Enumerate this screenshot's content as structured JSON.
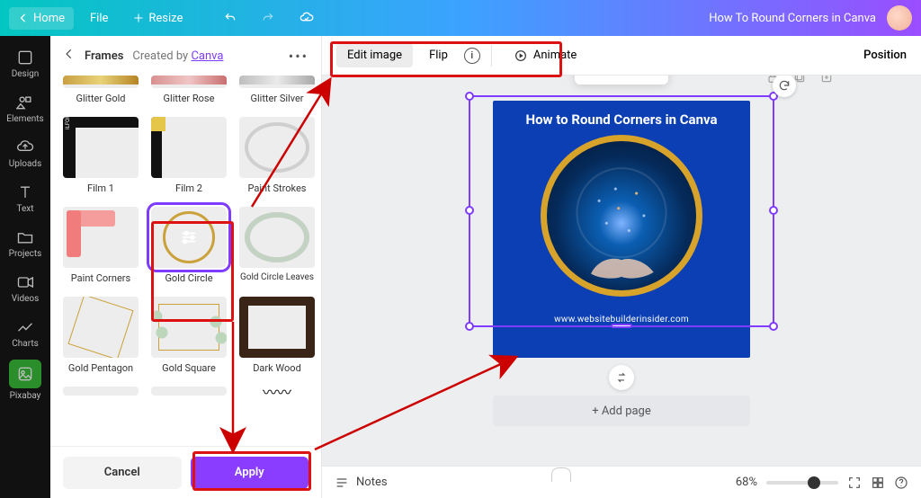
{
  "topbar": {
    "home": "Home",
    "file": "File",
    "resize": "Resize",
    "title": "How To Round Corners in Canva"
  },
  "rail": {
    "design": "Design",
    "elements": "Elements",
    "uploads": "Uploads",
    "text": "Text",
    "projects": "Projects",
    "videos": "Videos",
    "charts": "Charts",
    "pixabay": "Pixabay"
  },
  "panel": {
    "title": "Frames",
    "created_by": "Created by",
    "author": "Canva",
    "items": [
      {
        "id": "glitter-gold",
        "label": "Glitter Gold"
      },
      {
        "id": "glitter-rose",
        "label": "Glitter Rose"
      },
      {
        "id": "glitter-silver",
        "label": "Glitter Silver"
      },
      {
        "id": "film-1",
        "label": "Film 1"
      },
      {
        "id": "film-2",
        "label": "Film 2"
      },
      {
        "id": "paint-strokes",
        "label": "Paint Strokes"
      },
      {
        "id": "paint-corners",
        "label": "Paint Corners"
      },
      {
        "id": "gold-circle",
        "label": "Gold Circle",
        "selected": true
      },
      {
        "id": "gold-circle-leaves",
        "label": "Gold Circle Leaves"
      },
      {
        "id": "gold-pentagon",
        "label": "Gold Pentagon"
      },
      {
        "id": "gold-square",
        "label": "Gold Square"
      },
      {
        "id": "dark-wood",
        "label": "Dark Wood"
      }
    ],
    "cancel": "Cancel",
    "apply": "Apply"
  },
  "ctx": {
    "edit_image": "Edit image",
    "flip": "Flip",
    "animate": "Animate",
    "position": "Position"
  },
  "document": {
    "title": "How to Round Corners in Canva",
    "site": "www.websitebuilderinsider.com",
    "add_page": "+ Add page"
  },
  "status": {
    "notes": "Notes",
    "zoom": "68%"
  },
  "colors": {
    "accent": "#8b3dff",
    "selection": "#7f3bff",
    "highlight": "#d11",
    "doc_bg": "#0b3fb3",
    "gold": "#d7a32a"
  }
}
